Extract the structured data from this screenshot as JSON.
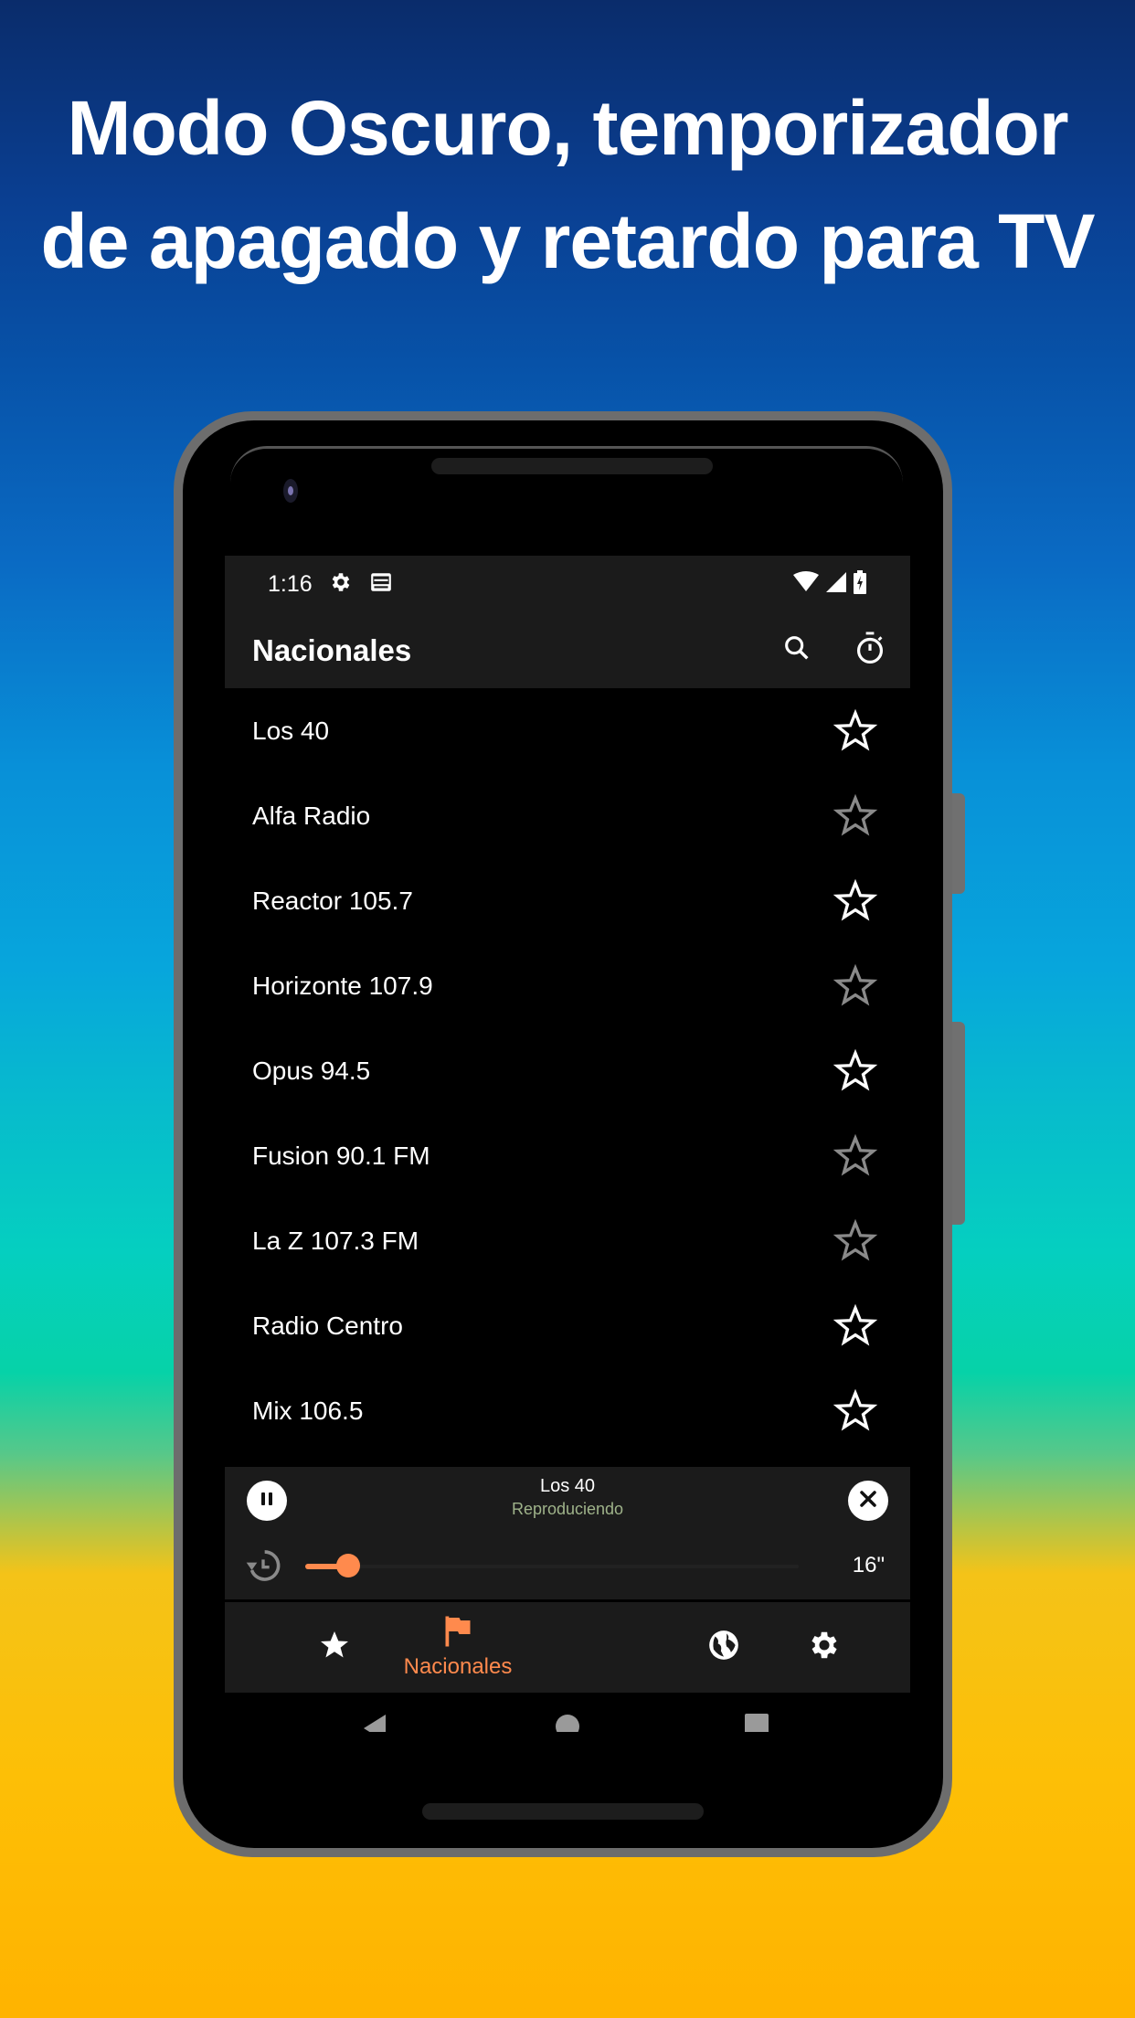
{
  "headline": {
    "line1": "Modo Oscuro, temporizador",
    "line2": "de apagado y retardo para TV"
  },
  "colors": {
    "accent": "#ff8a4d",
    "status_text": "#9fb38a",
    "surface": "#1b1b1b",
    "background": "#000000",
    "favorite_active": "#ffffff",
    "favorite_inactive": "#8a8a8a"
  },
  "statusbar": {
    "time": "1:16",
    "left_icons": [
      "gear-icon",
      "radio-app-icon"
    ],
    "right_icons": [
      "wifi-icon",
      "cell-signal-icon",
      "battery-charging-icon"
    ]
  },
  "appbar": {
    "title": "Nacionales",
    "actions": [
      "search-icon",
      "timer-icon"
    ]
  },
  "stations": [
    {
      "name": "Los 40",
      "favorite_style": "active"
    },
    {
      "name": "Alfa Radio",
      "favorite_style": "inactive"
    },
    {
      "name": "Reactor 105.7",
      "favorite_style": "active"
    },
    {
      "name": "Horizonte 107.9",
      "favorite_style": "inactive"
    },
    {
      "name": "Opus 94.5",
      "favorite_style": "active"
    },
    {
      "name": "Fusion 90.1 FM",
      "favorite_style": "inactive"
    },
    {
      "name": "La Z 107.3 FM",
      "favorite_style": "inactive"
    },
    {
      "name": "Radio Centro",
      "favorite_style": "active"
    },
    {
      "name": "Mix 106.5",
      "favorite_style": "active"
    }
  ],
  "player": {
    "station": "Los 40",
    "status": "Reproduciendo",
    "delay_label": "16\"",
    "delay_fraction": 0.05
  },
  "bottom_nav": {
    "items": [
      {
        "icon": "star-icon",
        "label": ""
      },
      {
        "icon": "flag-icon",
        "label": "Nacionales",
        "selected": true
      },
      {
        "icon": "globe-icon",
        "label": ""
      },
      {
        "icon": "gear-icon",
        "label": ""
      }
    ]
  },
  "system_nav": [
    "back-icon",
    "home-icon",
    "recents-icon"
  ]
}
